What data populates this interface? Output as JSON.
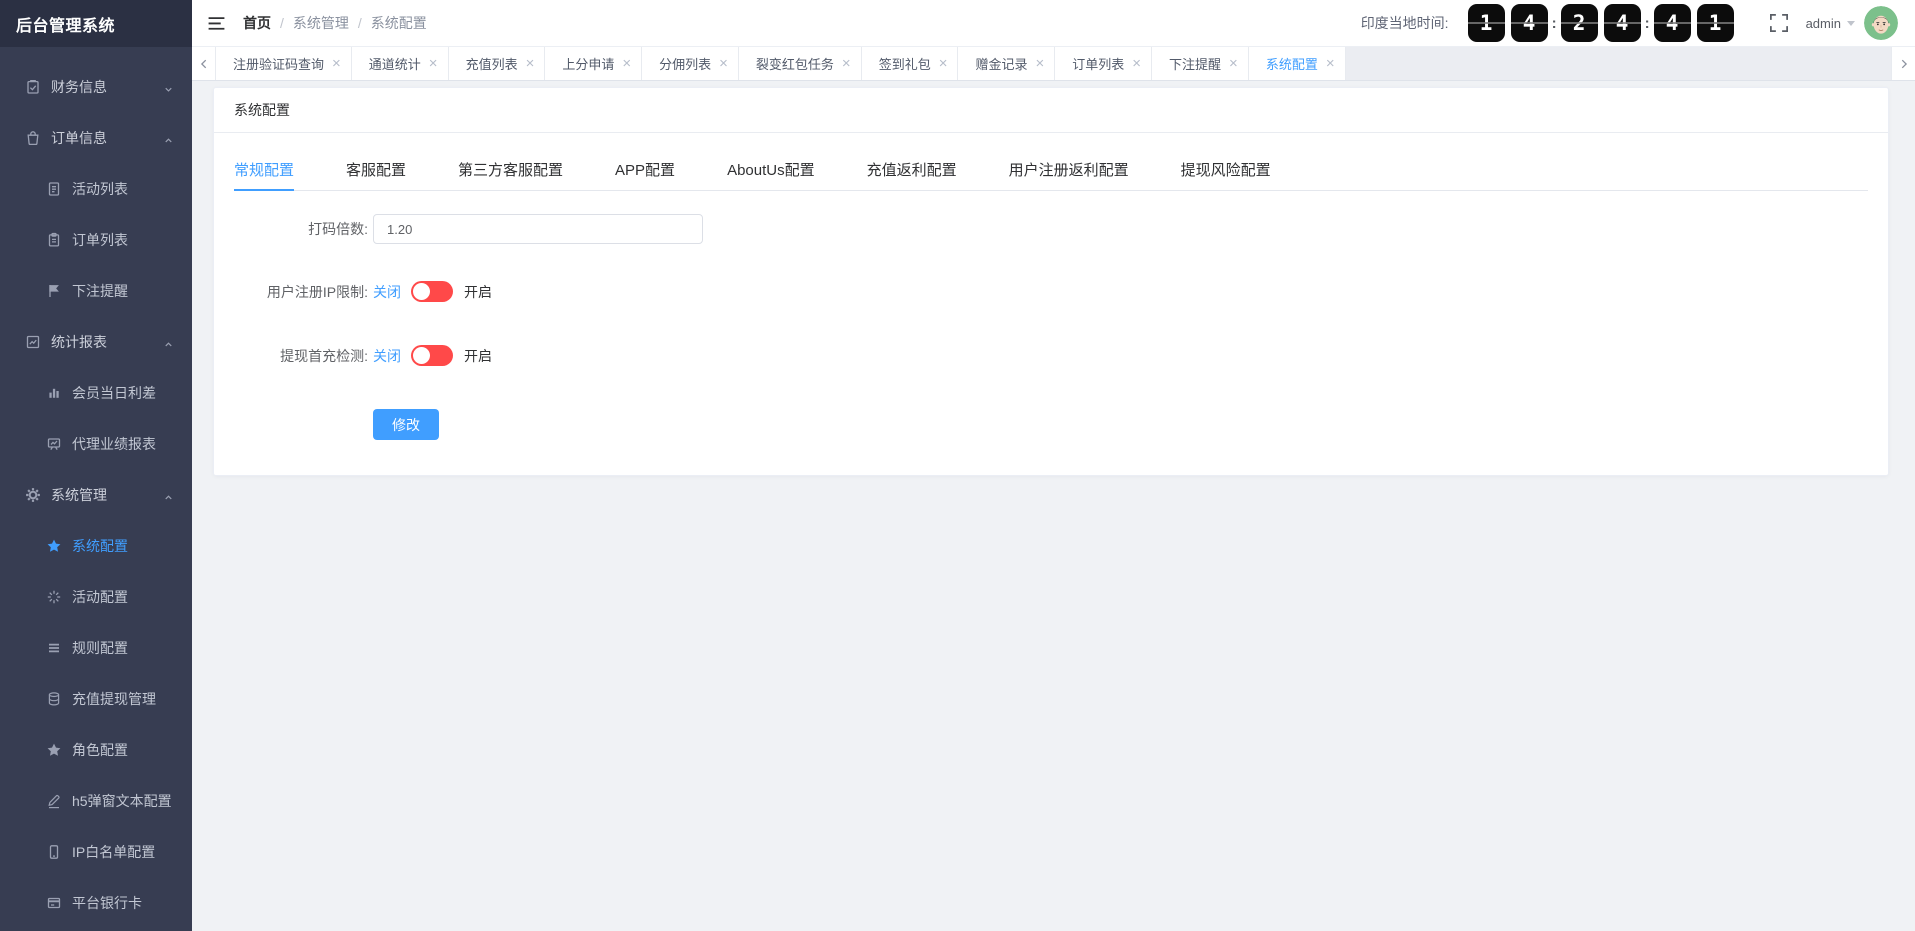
{
  "app": {
    "logo_title": "后台管理系统"
  },
  "header": {
    "breadcrumb": {
      "items": [
        "首页",
        "系统管理",
        "系统配置"
      ],
      "separator": "/"
    },
    "time_label": "印度当地时间:",
    "clock": [
      "1",
      "4",
      "2",
      "4",
      "4",
      "1"
    ],
    "clock_colon": ":",
    "clock_value": "14:24:41",
    "username": "admin"
  },
  "tabbar": {
    "close_glyph": "×",
    "tabs": [
      {
        "label": "注册验证码查询",
        "active": false
      },
      {
        "label": "通道统计",
        "active": false
      },
      {
        "label": "充值列表",
        "active": false
      },
      {
        "label": "上分申请",
        "active": false
      },
      {
        "label": "分佣列表",
        "active": false
      },
      {
        "label": "裂变红包任务",
        "active": false
      },
      {
        "label": "签到礼包",
        "active": false
      },
      {
        "label": "赠金记录",
        "active": false
      },
      {
        "label": "订单列表",
        "active": false
      },
      {
        "label": "下注提醒",
        "active": false
      },
      {
        "label": "系统配置",
        "active": true
      }
    ]
  },
  "sidebar": {
    "items": [
      {
        "label": "财务信息",
        "icon": "clipboard-check-icon",
        "type": "group",
        "expanded": false
      },
      {
        "label": "订单信息",
        "icon": "shopping-bag-icon",
        "type": "group",
        "expanded": true
      },
      {
        "label": "活动列表",
        "icon": "document-icon",
        "type": "sub",
        "active": false
      },
      {
        "label": "订单列表",
        "icon": "clipboard-icon",
        "type": "sub",
        "active": false
      },
      {
        "label": "下注提醒",
        "icon": "flag-icon",
        "type": "sub",
        "active": false
      },
      {
        "label": "统计报表",
        "icon": "chart-trend-icon",
        "type": "group",
        "expanded": true
      },
      {
        "label": "会员当日利差",
        "icon": "bar-chart-icon",
        "type": "sub",
        "active": false
      },
      {
        "label": "代理业绩报表",
        "icon": "presentation-chart-icon",
        "type": "sub",
        "active": false
      },
      {
        "label": "系统管理",
        "icon": "gear-icon",
        "type": "group",
        "expanded": true
      },
      {
        "label": "系统配置",
        "icon": "star-icon",
        "type": "sub",
        "active": true
      },
      {
        "label": "活动配置",
        "icon": "sparkle-icon",
        "type": "sub",
        "active": false
      },
      {
        "label": "规则配置",
        "icon": "list-icon",
        "type": "sub",
        "active": false
      },
      {
        "label": "充值提现管理",
        "icon": "database-icon",
        "type": "sub",
        "active": false
      },
      {
        "label": "角色配置",
        "icon": "star-icon",
        "type": "sub",
        "active": false
      },
      {
        "label": "h5弹窗文本配置",
        "icon": "pencil-icon",
        "type": "sub",
        "active": false
      },
      {
        "label": "IP白名单配置",
        "icon": "phone-icon",
        "type": "sub",
        "active": false
      },
      {
        "label": "平台银行卡",
        "icon": "bank-card-icon",
        "type": "sub",
        "active": false
      }
    ]
  },
  "card": {
    "title": "系统配置",
    "active_tab": "常规配置",
    "tabs": [
      "常规配置",
      "客服配置",
      "第三方客服配置",
      "APP配置",
      "AboutUs配置",
      "充值返利配置",
      "用户注册返利配置",
      "提现风险配置"
    ],
    "form": {
      "code_rate_label": "打码倍数:",
      "code_rate_value": "1.20",
      "register_ip_label": "用户注册IP限制:",
      "withdraw_check_label": "提现首充检测:",
      "switch_off": "关闭",
      "switch_on": "开启",
      "submit": "修改"
    }
  },
  "colors": {
    "accent": "#409eff",
    "switch_red": "#ff4949",
    "sidebar_bg": "#373d52",
    "logo_bg": "#2b3043",
    "page_bg": "#f0f2f5",
    "avatar_bg": "#7cc08b",
    "clock_bg": "#0c0c0c"
  }
}
